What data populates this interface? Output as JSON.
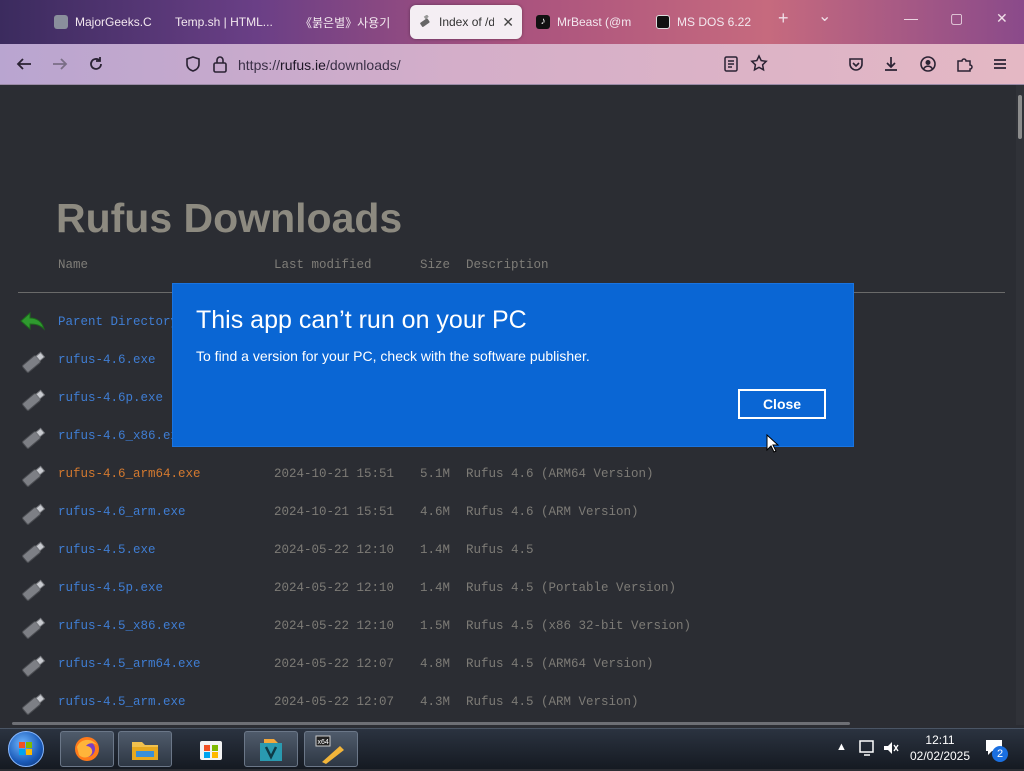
{
  "browser": {
    "tabs": [
      {
        "title": "MajorGeeks.C",
        "active": false
      },
      {
        "title": "Temp.sh | HTML...",
        "active": false
      },
      {
        "title": "《붉은별》사용기",
        "active": false
      },
      {
        "title": "Index of /d",
        "active": true
      },
      {
        "title": "MrBeast (@m",
        "active": false
      },
      {
        "title": "MS DOS 6.22",
        "active": false
      }
    ],
    "new_tab": "+",
    "tab_list": "⌄",
    "window_controls": {
      "minimize": "—",
      "maximize": "▢",
      "close": "✕"
    },
    "url": {
      "scheme": "https://",
      "host": "rufus.ie",
      "path": "/downloads/"
    }
  },
  "page": {
    "title": "Rufus Downloads",
    "columns": {
      "name": "Name",
      "modified": "Last modified",
      "size": "Size",
      "description": "Description"
    },
    "parent_label": "Parent Directory",
    "files": [
      {
        "name": "rufus-4.6.exe",
        "date": "",
        "size": "",
        "desc": "",
        "visited": false
      },
      {
        "name": "rufus-4.6p.exe",
        "date": "",
        "size": "",
        "desc": "",
        "visited": false
      },
      {
        "name": "rufus-4.6_x86.exe",
        "date": "",
        "size": "",
        "desc": "",
        "visited": false
      },
      {
        "name": "rufus-4.6_arm64.exe",
        "date": "2024-10-21 15:51",
        "size": "5.1M",
        "desc": "Rufus 4.6 (ARM64 Version)",
        "visited": true
      },
      {
        "name": "rufus-4.6_arm.exe",
        "date": "2024-10-21 15:51",
        "size": "4.6M",
        "desc": "Rufus 4.6 (ARM Version)",
        "visited": false
      },
      {
        "name": "rufus-4.5.exe",
        "date": "2024-05-22 12:10",
        "size": "1.4M",
        "desc": "Rufus 4.5",
        "visited": false
      },
      {
        "name": "rufus-4.5p.exe",
        "date": "2024-05-22 12:10",
        "size": "1.4M",
        "desc": "Rufus 4.5 (Portable Version)",
        "visited": false
      },
      {
        "name": "rufus-4.5_x86.exe",
        "date": "2024-05-22 12:10",
        "size": "1.5M",
        "desc": "Rufus 4.5 (x86 32-bit Version)",
        "visited": false
      },
      {
        "name": "rufus-4.5_arm64.exe",
        "date": "2024-05-22 12:07",
        "size": "4.8M",
        "desc": "Rufus 4.5 (ARM64 Version)",
        "visited": false
      },
      {
        "name": "rufus-4.5_arm.exe",
        "date": "2024-05-22 12:07",
        "size": "4.3M",
        "desc": "Rufus 4.5 (ARM Version)",
        "visited": false
      }
    ]
  },
  "dialog": {
    "title": "This app can’t run on your PC",
    "message": "To find a version for your PC, check with the software publisher.",
    "close_label": "Close"
  },
  "taskbar": {
    "clock_time": "12:11",
    "clock_date": "02/02/2025",
    "notification_count": "2",
    "pinned": [
      "start-orb",
      "firefox",
      "file-explorer",
      "microsoft-store",
      "portable-app",
      "x64-app"
    ]
  },
  "colors": {
    "dialog_blue": "#0a66d4",
    "link": "#3f7dd3",
    "visited_link": "#d3792f",
    "page_bg": "#2b2d33"
  }
}
